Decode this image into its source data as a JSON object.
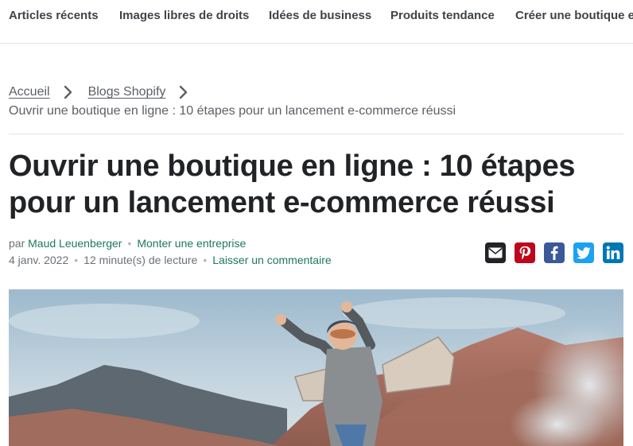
{
  "topnav": {
    "items": [
      {
        "label": "Articles récents"
      },
      {
        "label": "Images libres de droits"
      },
      {
        "label": "Idées de business"
      },
      {
        "label": "Produits tendance"
      },
      {
        "label": "Créer une boutique en ligne"
      }
    ]
  },
  "breadcrumb": {
    "home": "Accueil",
    "blog": "Blogs Shopify",
    "current": "Ouvrir une boutique en ligne : 10 étapes pour un lancement e-commerce réussi"
  },
  "article": {
    "title": "Ouvrir une boutique en ligne : 10 étapes pour un lancement e-commerce réussi",
    "by": "par",
    "author": "Maud Leuenberger",
    "category": "Monter une entreprise",
    "date": "4 janv. 2022",
    "reading_time": "12 minute(s) de lecture",
    "comment_link": "Laisser un commentaire"
  },
  "share": {
    "buttons": [
      {
        "icon": "email-icon",
        "color": "#212326"
      },
      {
        "icon": "pinterest-icon",
        "color": "#bd081c"
      },
      {
        "icon": "facebook-icon",
        "color": "#3b5998"
      },
      {
        "icon": "twitter-icon",
        "color": "#1da1f2"
      },
      {
        "icon": "linkedin-icon",
        "color": "#0077b5"
      }
    ]
  },
  "colors": {
    "link_green": "#1c7a5a",
    "text_dark": "#212326",
    "text_muted": "#5c6066"
  }
}
